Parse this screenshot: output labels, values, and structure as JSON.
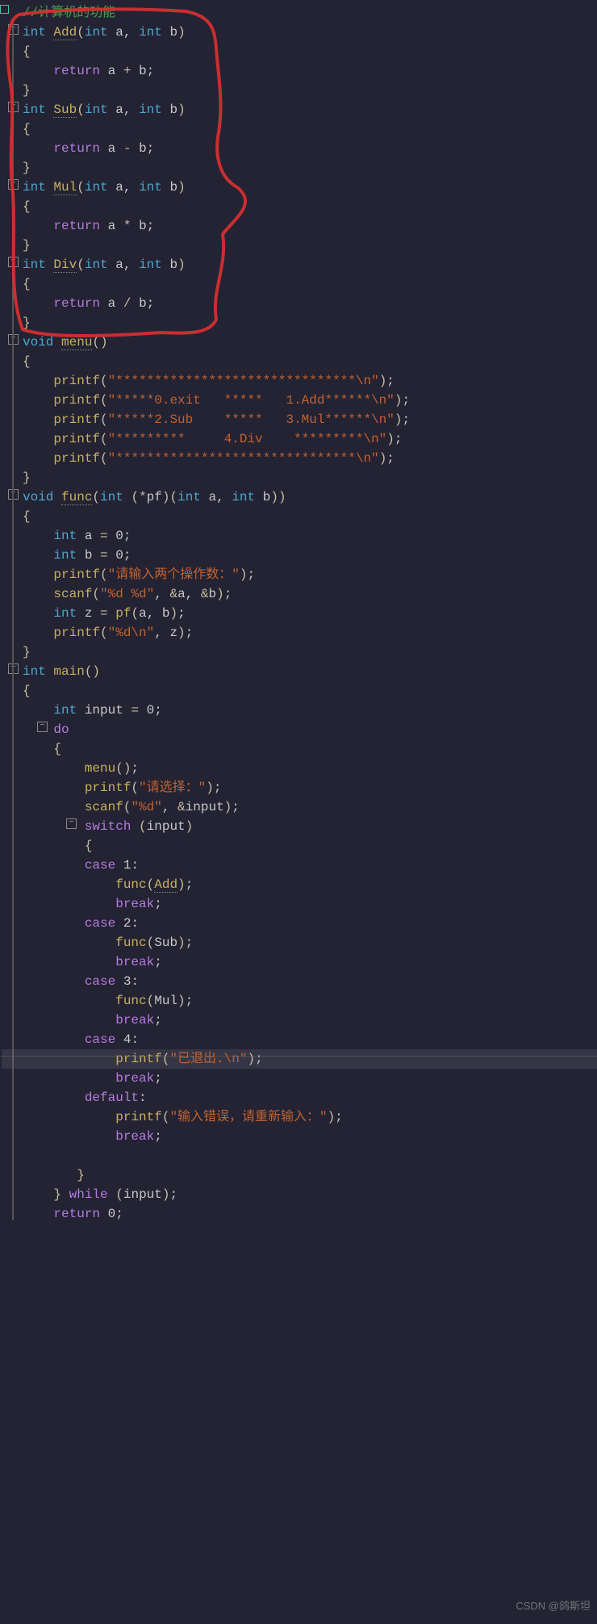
{
  "watermark": "CSDN @鸽斯坦",
  "lines": [
    {
      "y": 0,
      "bp": true,
      "html": "<span class='cm'>//计算机的功能</span>"
    },
    {
      "y": 1,
      "fold": true,
      "html": "<span class='kw'>int</span> <span class='fn'>Add</span><span class='par'>(</span><span class='kw'>int</span> <span class='id'>a</span>, <span class='kw'>int</span> <span class='id'>b</span><span class='par'>)</span>"
    },
    {
      "y": 2,
      "html": "<span class='brace'>{</span>"
    },
    {
      "y": 3,
      "html": "    <span class='kw2'>return</span> <span class='id'>a</span> <span class='op'>+</span> <span class='id'>b</span>;"
    },
    {
      "y": 4,
      "html": "<span class='brace'>}</span>"
    },
    {
      "y": 5,
      "fold": true,
      "html": "<span class='kw'>int</span> <span class='fn'>Sub</span><span class='par'>(</span><span class='kw'>int</span> <span class='id'>a</span>, <span class='kw'>int</span> <span class='id'>b</span><span class='par'>)</span>"
    },
    {
      "y": 6,
      "html": "<span class='brace'>{</span>"
    },
    {
      "y": 7,
      "html": "    <span class='kw2'>return</span> <span class='id'>a</span> <span class='op'>-</span> <span class='id'>b</span>;"
    },
    {
      "y": 8,
      "html": "<span class='brace'>}</span>"
    },
    {
      "y": 9,
      "fold": true,
      "html": "<span class='kw'>int</span> <span class='fn'>Mul</span><span class='par'>(</span><span class='kw'>int</span> <span class='id'>a</span>, <span class='kw'>int</span> <span class='id'>b</span><span class='par'>)</span>"
    },
    {
      "y": 10,
      "html": "<span class='brace'>{</span>"
    },
    {
      "y": 11,
      "html": "    <span class='kw2'>return</span> <span class='id'>a</span> <span class='op'>*</span> <span class='id'>b</span>;"
    },
    {
      "y": 12,
      "html": "<span class='brace'>}</span>"
    },
    {
      "y": 13,
      "fold": true,
      "html": "<span class='kw'>int</span> <span class='fn'>Div</span><span class='par'>(</span><span class='kw'>int</span> <span class='id'>a</span>, <span class='kw'>int</span> <span class='id'>b</span><span class='par'>)</span>"
    },
    {
      "y": 14,
      "html": "<span class='brace'>{</span>"
    },
    {
      "y": 15,
      "html": "    <span class='kw2'>return</span> <span class='id'>a</span> <span class='op'>/</span> <span class='id'>b</span>;"
    },
    {
      "y": 16,
      "html": "<span class='brace'>}</span>"
    },
    {
      "y": 17,
      "fold": true,
      "html": "<span class='kw'>void</span> <span class='fn'>menu</span><span class='par'>()</span>"
    },
    {
      "y": 18,
      "html": "<span class='brace'>{</span>"
    },
    {
      "y": 19,
      "html": "    <span class='fn-call'>printf</span><span class='par'>(</span><span class='str'>\"*******************************\\n\"</span><span class='par'>)</span>;"
    },
    {
      "y": 20,
      "html": "    <span class='fn-call'>printf</span><span class='par'>(</span><span class='str'>\"*****0.exit   *****   1.Add******\\n\"</span><span class='par'>)</span>;"
    },
    {
      "y": 21,
      "html": "    <span class='fn-call'>printf</span><span class='par'>(</span><span class='str'>\"*****2.Sub    *****   3.Mul******\\n\"</span><span class='par'>)</span>;"
    },
    {
      "y": 22,
      "html": "    <span class='fn-call'>printf</span><span class='par'>(</span><span class='str'>\"*********     4.Div    *********\\n\"</span><span class='par'>)</span>;"
    },
    {
      "y": 23,
      "html": "    <span class='fn-call'>printf</span><span class='par'>(</span><span class='str'>\"*******************************\\n\"</span><span class='par'>)</span>;"
    },
    {
      "y": 24,
      "html": "<span class='brace'>}</span>"
    },
    {
      "y": 25,
      "fold": true,
      "html": "<span class='kw'>void</span> <span class='fn'>func</span><span class='par'>(</span><span class='kw'>int</span> <span class='par'>(</span><span class='op'>*</span><span class='id'>pf</span><span class='par'>)</span><span class='par'>(</span><span class='kw'>int</span> <span class='id'>a</span>, <span class='kw'>int</span> <span class='id'>b</span><span class='par'>))</span>"
    },
    {
      "y": 26,
      "html": "<span class='brace'>{</span>"
    },
    {
      "y": 27,
      "html": "    <span class='kw'>int</span> <span class='id'>a</span> <span class='op'>=</span> <span class='num'>0</span>;"
    },
    {
      "y": 28,
      "html": "    <span class='kw'>int</span> <span class='id'>b</span> <span class='op'>=</span> <span class='num'>0</span>;"
    },
    {
      "y": 29,
      "html": "    <span class='fn-call'>printf</span><span class='par'>(</span><span class='str'>\"请输入两个操作数：\"</span><span class='par'>)</span>;"
    },
    {
      "y": 30,
      "html": "    <span class='fn-call'>scanf</span><span class='par'>(</span><span class='str'>\"%d %d\"</span>, <span class='op'>&amp;</span><span class='id'>a</span>, <span class='op'>&amp;</span><span class='id'>b</span><span class='par'>)</span>;"
    },
    {
      "y": 31,
      "html": "    <span class='kw'>int</span> <span class='id'>z</span> <span class='op'>=</span> <span class='fn-call'>pf</span><span class='par'>(</span><span class='id'>a</span>, <span class='id'>b</span><span class='par'>)</span>;"
    },
    {
      "y": 32,
      "html": "    <span class='fn-call'>printf</span><span class='par'>(</span><span class='str'>\"%d\\n\"</span>, <span class='id'>z</span><span class='par'>)</span>;"
    },
    {
      "y": 33,
      "html": "<span class='brace'>}</span>"
    },
    {
      "y": 34,
      "fold": true,
      "html": "<span class='kw'>int</span> <span class='fn-call'>main</span><span class='par'>()</span>"
    },
    {
      "y": 35,
      "html": "<span class='brace'>{</span>"
    },
    {
      "y": 36,
      "html": "    <span class='kw'>int</span> <span class='id'>input</span> <span class='op'>=</span> <span class='num'>0</span>;"
    },
    {
      "y": 37,
      "fold": true,
      "indent": 4,
      "html": "    <span class='kw2'>do</span>"
    },
    {
      "y": 38,
      "html": "    <span class='brace'>{</span>"
    },
    {
      "y": 39,
      "html": "        <span class='fn-call'>menu</span><span class='par'>()</span>;"
    },
    {
      "y": 40,
      "html": "        <span class='fn-call'>printf</span><span class='par'>(</span><span class='str'>\"请选择：\"</span><span class='par'>)</span>;"
    },
    {
      "y": 41,
      "html": "        <span class='fn-call'>scanf</span><span class='par'>(</span><span class='str'>\"%d\"</span>, <span class='op'>&amp;</span><span class='id'>input</span><span class='par'>)</span>;"
    },
    {
      "y": 42,
      "fold": true,
      "indent": 8,
      "html": "        <span class='kw2'>switch</span> <span class='par'>(</span><span class='id'>input</span><span class='par'>)</span>"
    },
    {
      "y": 43,
      "html": "        <span class='brace'>{</span>"
    },
    {
      "y": 44,
      "html": "        <span class='kw2'>case</span> <span class='num'>1</span>:"
    },
    {
      "y": 45,
      "html": "            <span class='fn-call'>func</span><span class='par'>(</span><span class='fn'>Add</span><span class='par'>)</span>;"
    },
    {
      "y": 46,
      "html": "            <span class='kw2'>break</span>;"
    },
    {
      "y": 47,
      "html": "        <span class='kw2'>case</span> <span class='num'>2</span>:"
    },
    {
      "y": 48,
      "html": "            <span class='fn-call'>func</span><span class='par'>(</span><span class='id'>Sub</span><span class='par'>)</span>;"
    },
    {
      "y": 49,
      "html": "            <span class='kw2'>break</span>;"
    },
    {
      "y": 50,
      "html": "        <span class='kw2'>case</span> <span class='num'>3</span>:"
    },
    {
      "y": 51,
      "html": "            <span class='fn-call'>func</span><span class='par'>(</span><span class='id'>Mul</span><span class='par'>)</span>;"
    },
    {
      "y": 52,
      "html": "            <span class='kw2'>break</span>;"
    },
    {
      "y": 53,
      "html": "        <span class='kw2'>case</span> <span class='num'>4</span>:"
    },
    {
      "y": 54,
      "hl": true,
      "html": "            <span class='fn-call'>printf</span><span class='par'>(</span><span class='str'>\"已退出.\\n\"</span><span class='par'>)</span>;"
    },
    {
      "y": 55,
      "html": "            <span class='kw2'>break</span>;"
    },
    {
      "y": 56,
      "html": "        <span class='kw2'>default</span>:"
    },
    {
      "y": 57,
      "html": "            <span class='fn-call'>printf</span><span class='par'>(</span><span class='str'>\"输入错误，请重新输入：\"</span><span class='par'>)</span>;"
    },
    {
      "y": 58,
      "html": "            <span class='kw2'>break</span>;"
    },
    {
      "y": 59,
      "html": ""
    },
    {
      "y": 60,
      "html": "       <span class='brace'>}</span>"
    },
    {
      "y": 61,
      "html": "    <span class='brace'>}</span> <span class='kw2'>while</span> <span class='par'>(</span><span class='id'>input</span><span class='par'>)</span>;"
    },
    {
      "y": 62,
      "html": "    <span class='kw2'>return</span> <span class='num'>0</span>;"
    }
  ],
  "annotation_color": "#d83030",
  "highlight_line_index": 54
}
